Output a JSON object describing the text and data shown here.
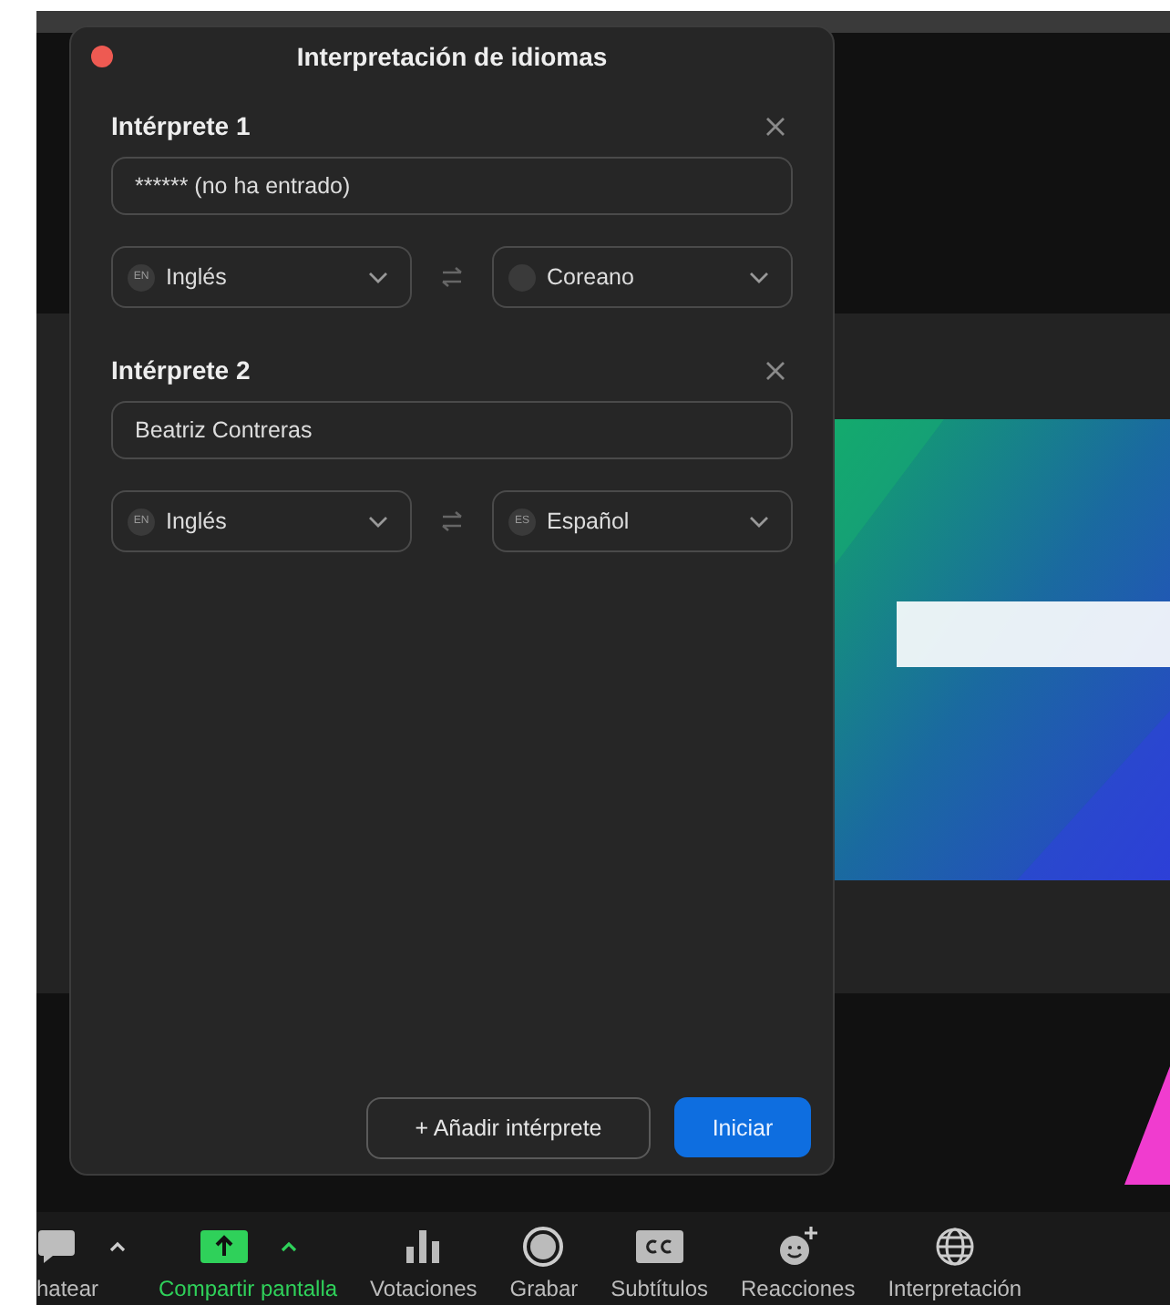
{
  "dialog": {
    "title": "Interpretación de idiomas",
    "interpreters": [
      {
        "heading": "Intérprete 1",
        "name": "****** (no ha entrado)",
        "from": {
          "code": "EN",
          "label": "Inglés"
        },
        "to": {
          "label": "Coreano"
        }
      },
      {
        "heading": "Intérprete 2",
        "name": "Beatriz Contreras",
        "from": {
          "code": "EN",
          "label": "Inglés"
        },
        "to": {
          "code": "ES",
          "label": "Español"
        }
      }
    ],
    "add_button": "+ Añadir intérprete",
    "start_button": "Iniciar"
  },
  "toolbar": [
    {
      "kind": "chat",
      "label": "hatear",
      "has_menu": true
    },
    {
      "kind": "share",
      "label": "Compartir pantalla",
      "has_menu": true
    },
    {
      "kind": "polls",
      "label": "Votaciones",
      "has_menu": false
    },
    {
      "kind": "record",
      "label": "Grabar",
      "has_menu": false
    },
    {
      "kind": "captions",
      "label": "Subtítulos",
      "has_menu": false
    },
    {
      "kind": "reactions",
      "label": "Reacciones",
      "has_menu": false
    },
    {
      "kind": "interpretation",
      "label": "Interpretación",
      "has_menu": false
    }
  ]
}
